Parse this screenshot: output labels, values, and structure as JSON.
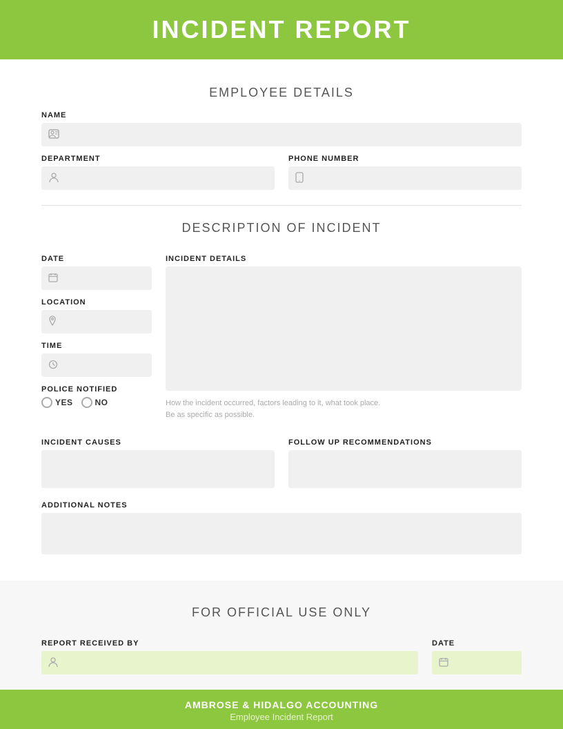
{
  "header": {
    "title": "INCIDENT REPORT"
  },
  "employee_details": {
    "section_title": "EMPLOYEE DETAILS",
    "name_label": "NAME",
    "name_placeholder": "",
    "name_icon": "👤",
    "department_label": "DEPARTMENT",
    "department_icon": "👥",
    "phone_label": "PHONE NUMBER",
    "phone_icon": "📱"
  },
  "incident_description": {
    "section_title": "DESCRIPTION OF INCIDENT",
    "date_label": "DATE",
    "date_icon": "📅",
    "location_label": "LOCATION",
    "location_icon": "📍",
    "time_label": "TIME",
    "time_icon": "🕐",
    "police_notified_label": "POLICE NOTIFIED",
    "police_yes_label": "YES",
    "police_no_label": "NO",
    "incident_details_label": "INCIDENT DETAILS",
    "incident_details_hint_line1": "How the incident occurred, factors leading to it, what took place.",
    "incident_details_hint_line2": "Be as specific as possible.",
    "incident_causes_label": "INCIDENT CAUSES",
    "follow_up_label": "FOLLOW UP RECOMMENDATIONS",
    "additional_notes_label": "ADDITIONAL NOTES"
  },
  "official_use": {
    "section_title": "FOR OFFICIAL USE ONLY",
    "report_received_label": "REPORT RECEIVED BY",
    "date_label": "DATE",
    "person_icon": "👤",
    "calendar_icon": "📅"
  },
  "footer": {
    "company": "AMBROSE & HIDALGO ACCOUNTING",
    "subtitle": "Employee Incident Report"
  }
}
